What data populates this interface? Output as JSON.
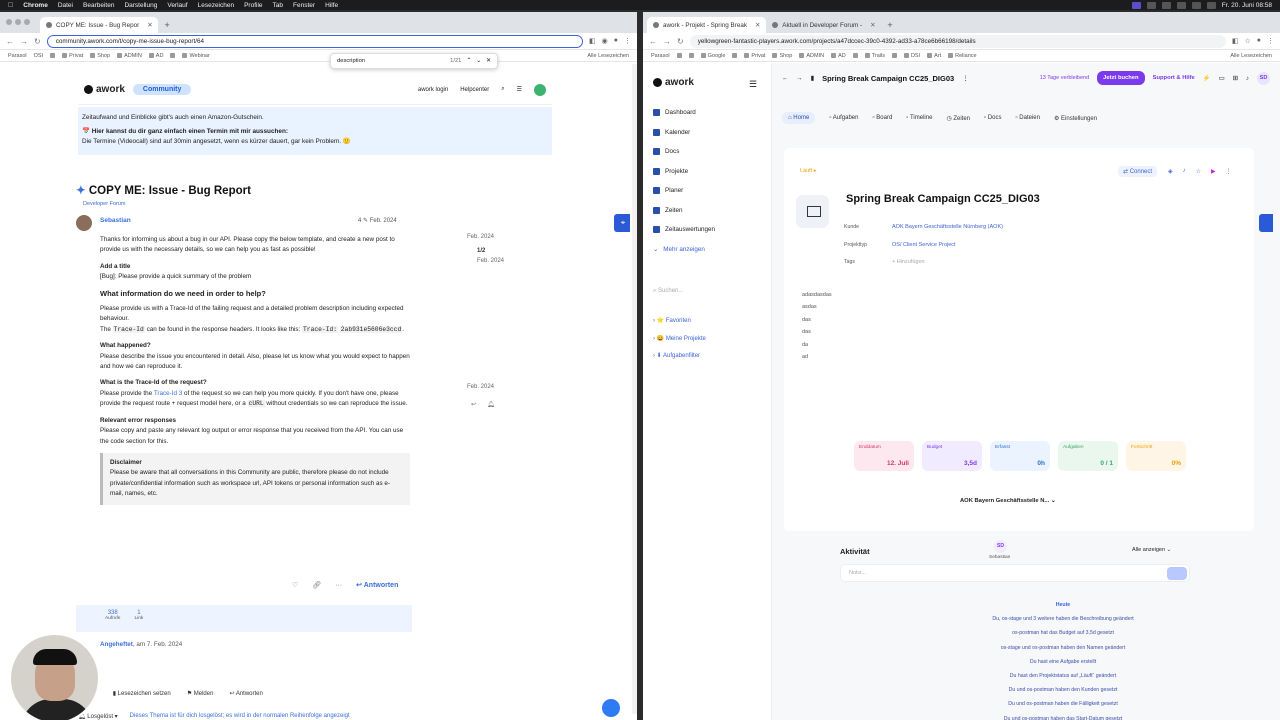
{
  "menubar": {
    "app": "Chrome",
    "items": [
      "Datei",
      "Bearbeiten",
      "Darstellung",
      "Verlauf",
      "Lesezeichen",
      "Profile",
      "Tab",
      "Fenster",
      "Hilfe"
    ],
    "clock": "Fr. 20. Juni 08:58"
  },
  "left": {
    "tab": "COPY ME: Issue - Bug Repor",
    "url": "community.awork.com/t/copy-me-issue-bug-report/64",
    "bookmarks": [
      "Parasol",
      "OSI",
      "Google",
      "Privat",
      "Shop",
      "ADMIN",
      "AD",
      "",
      "Webinar"
    ],
    "bookmarks_right": "Alle Lesezeichen",
    "find": {
      "query": "description",
      "count": "1/21"
    },
    "header": {
      "logo": "awork",
      "badge": "Community",
      "login": "awork login",
      "help": "Helpcenter"
    },
    "banner": {
      "line1": "Zeitaufwand und Einblicke gibt's auch einen Amazon-Gutschein.",
      "line2": "📅 Hier kannst du dir ganz einfach einen Termin mit mir aussuchen:",
      "line3": "Die Termine (Videocall) sind auf 30min angesetzt, wenn es kürzer dauert, gar kein Problem. 🙂"
    },
    "title": "COPY ME: Issue - Bug Report",
    "category": "Developer Forum",
    "author": "Sebastian",
    "post_meta": "4 ✎  Feb. 2024",
    "side": {
      "date1": "Feb. 2024",
      "progress": "1/2",
      "date2": "Feb. 2024",
      "date3": "Feb. 2024"
    },
    "body": {
      "p1": "Thanks for informing us about a bug in our API. Please copy the below template, and create a new post to provide us with the necessary details, so we can help you as fast as possible!",
      "h_title": "Add a title",
      "p_title": "[Bug]: Please provide a quick summary of the problem",
      "h2": "What information do we need in order to help?",
      "p2": "Please provide us with a Trace-Id of the failing request and a detailed problem description including expected behaviour.",
      "p3a": "The",
      "code1": "Trace-Id",
      "p3b": "can be found in the response headers. It looks like this:",
      "code2": "Trace-Id:",
      "code3": "2ab931e5606e3ccd",
      "h_happened": "What happened?",
      "p_happened": "Please describe the issue you encountered in detail. Also, please let us know what you would expect to happen and how we can reproduce it.",
      "h_trace": "What is the Trace-Id of the request?",
      "p_trace_a": "Please provide the",
      "trace_link": "Trace-Id 3",
      "p_trace_b": "of the request so we can help you more quickly. If you don't have one, please provide the request route + request model here, or a",
      "code4": "cURL",
      "p_trace_c": "without credentials so we can reproduce the issue.",
      "h_errors": "Relevant error responses",
      "p_errors": "Please copy and paste any relevant log output or error response that you received from the API. You can use the code section for this.",
      "disc_h": "Disclaimer",
      "disc_p": "Please be aware that all conversations in this Community are public, therefore please do not include private/confidential information such as workspace url, API tokens or personal information such as e-mail, names, etc."
    },
    "answer": "Antworten",
    "stats": [
      {
        "n": "338",
        "l": "Aufrufe"
      },
      {
        "n": "1",
        "l": "Link"
      }
    ],
    "pinned": "Angeheftet",
    "pinned_date": ", am 7. Feb. 2024",
    "footer": [
      "en",
      "Lesezeichen setzen",
      "Melden",
      "Antworten"
    ],
    "notif": {
      "label": "Losgelöst",
      "text": "Dieses Thema ist für dich losgelöst; es wird in der normalen Reihenfolge angezeigt"
    }
  },
  "right": {
    "tabs": [
      "awork - Projekt - Spring Break",
      "Aktuell in Developer Forum -"
    ],
    "url": "yellowgreen-fantastic-players.awork.com/projects/a47dccec-39c0-4392-ad33-a78ce6b66198/details",
    "bookmarks": [
      "Parasol",
      "",
      "",
      "Google",
      "",
      "Privat",
      "Shop",
      "ADMIN",
      "AD",
      "",
      "Trails",
      "",
      "DSI",
      "Art",
      "Reliance"
    ],
    "bookmarks_right": "Alle Lesezeichen",
    "nav": [
      "Dashboard",
      "Kalender",
      "Docs",
      "Projekte",
      "Planer",
      "Zeiten",
      "Zeitauswertungen",
      "Mehr anzeigen"
    ],
    "search": "Suchen...",
    "groups": [
      "Favoriten",
      "Meine Projekte",
      "Aufgabenfilter"
    ],
    "project": "Spring Break Campaign CC25_DIG03",
    "days": "13 Tage verbleibend",
    "book": "Jetzt buchen",
    "support": "Support & Hilfe",
    "user": "SD",
    "ptabs": [
      "Home",
      "Aufgaben",
      "Board",
      "Timeline",
      "Zeiten",
      "Docs",
      "Dateien",
      "Einstellungen"
    ],
    "status": "Läuft",
    "connect": "Connect",
    "meta_keys": [
      "Kunde",
      "Projekttyp",
      "Tags"
    ],
    "meta_vals": [
      "AOK Bayern Geschäftsstelle Nürnberg (AOK)",
      "OS/ Client Service Project",
      "+ Hinzufügen"
    ],
    "desc": [
      "adasdasdas",
      "asdas",
      "das",
      "das",
      "da",
      "ad"
    ],
    "kpis": [
      {
        "l": "Enddatum",
        "v": "12. Juli"
      },
      {
        "l": "Budget",
        "v": "3,5d"
      },
      {
        "l": "Erfasst",
        "v": "0h"
      },
      {
        "l": "Aufgaben",
        "v": "0 / 1"
      },
      {
        "l": "Fortschritt",
        "v": "0%"
      }
    ],
    "customer": "AOK Bayern Geschäftsstelle N...",
    "owner": "SD",
    "owner_name": "Sebastian",
    "activity": "Aktivität",
    "show_all": "Alle anzeigen",
    "note": "Notiz...",
    "today": "Heute",
    "feed": [
      "Du, os-stage und 3 weitere haben die Beschreibung geändert",
      "os-postman hat das Budget auf 3,5d gesetzt",
      "os-stage und os-postman haben den Namen geändert",
      "Du hast eine Aufgabe erstellt",
      "Du hast den Projektstatus auf „Läuft“ geändert",
      "Du und os-postman haben den Kunden gesetzt",
      "Du und os-postman haben die Fälligkeit gesetzt",
      "Du und os-postman haben das Start-Datum gesetzt"
    ]
  }
}
